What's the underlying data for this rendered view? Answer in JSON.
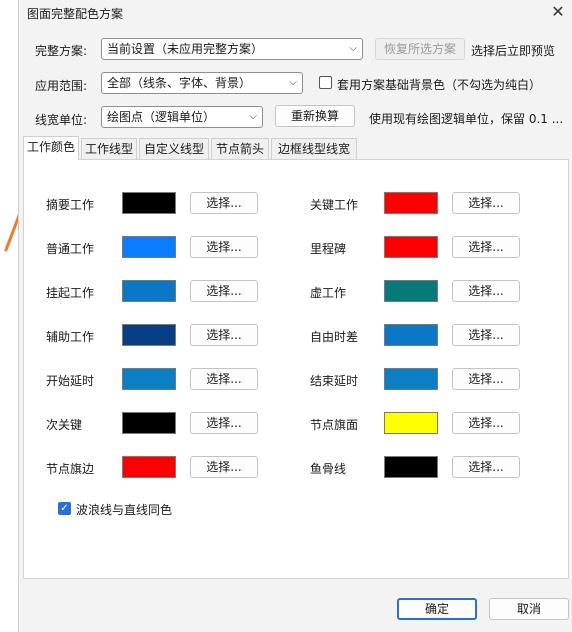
{
  "window": {
    "title": "图面完整配色方案",
    "close": "✕"
  },
  "scheme": {
    "label": "完整方案:",
    "value": "当前设置（未应用完整方案）",
    "restore_button": "恢复所选方案",
    "hint": "选择后立即预览"
  },
  "scope": {
    "label": "应用范围:",
    "value": "全部（线条、字体、背景）",
    "checkbox_label": "套用方案基础背景色（不勾选为纯白）",
    "checked": false
  },
  "linewidth": {
    "label": "线宽单位:",
    "value": "绘图点（逻辑单位）",
    "recalc_button": "重新换算",
    "hint": "使用现有绘图逻辑单位，保留 0.1 ..."
  },
  "tabs": [
    "工作颜色",
    "工作线型",
    "自定义线型",
    "节点箭头",
    "边框线型线宽"
  ],
  "active_tab": 0,
  "pick_label": "选择...",
  "colors_left": [
    {
      "label": "摘要工作",
      "color": "#000000"
    },
    {
      "label": "普通工作",
      "color": "#0a7cff"
    },
    {
      "label": "挂起工作",
      "color": "#0a78c6"
    },
    {
      "label": "辅助工作",
      "color": "#063f86"
    },
    {
      "label": "开始延时",
      "color": "#0a7fc4"
    },
    {
      "label": "次关键",
      "color": "#000000"
    },
    {
      "label": "节点旗边",
      "color": "#ff0000"
    }
  ],
  "colors_right": [
    {
      "label": "关键工作",
      "color": "#ff0000"
    },
    {
      "label": "里程碑",
      "color": "#ff0000"
    },
    {
      "label": "虚工作",
      "color": "#057a78"
    },
    {
      "label": "自由时差",
      "color": "#0a78c6"
    },
    {
      "label": "结束延时",
      "color": "#0a7fc4"
    },
    {
      "label": "节点旗面",
      "color": "#ffff00"
    },
    {
      "label": "鱼骨线",
      "color": "#000000"
    }
  ],
  "wavy": {
    "label": "波浪线与直线同色",
    "checked": true
  },
  "footer": {
    "ok": "确定",
    "cancel": "取消"
  },
  "accent": "#2a6fd6",
  "annotation_color": "#f07a2a"
}
